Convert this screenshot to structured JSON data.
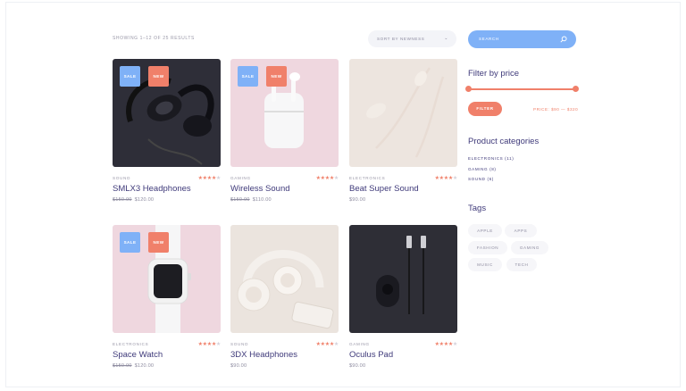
{
  "toolbar": {
    "results": "SHOWING 1–12 OF 25 RESULTS",
    "sort": "SORT BY NEWNESS",
    "search_placeholder": "SEARCH"
  },
  "products": [
    {
      "category": "SOUND",
      "title": "SMLX3 Headphones",
      "old_price": "$150.00",
      "price": "$120.00",
      "rating": 4,
      "badges": [
        "SALE",
        "NEW"
      ]
    },
    {
      "category": "GAMING",
      "title": "Wireless Sound",
      "old_price": "$150.00",
      "price": "$110.00",
      "rating": 4,
      "badges": [
        "SALE",
        "NEW"
      ]
    },
    {
      "category": "ELECTRONICS",
      "title": "Beat Super Sound",
      "old_price": "",
      "price": "$90.00",
      "rating": 4,
      "badges": []
    },
    {
      "category": "ELECTRONICS",
      "title": "Space Watch",
      "old_price": "$150.00",
      "price": "$120.00",
      "rating": 4,
      "badges": [
        "SALE",
        "NEW"
      ]
    },
    {
      "category": "SOUND",
      "title": "3DX Headphones",
      "old_price": "",
      "price": "$90.00",
      "rating": 4,
      "badges": []
    },
    {
      "category": "GAMING",
      "title": "Oculus Pad",
      "old_price": "",
      "price": "$90.00",
      "rating": 4,
      "badges": []
    }
  ],
  "sidebar": {
    "filter_heading": "Filter by price",
    "filter_button": "FILTER",
    "price_range": "PRICE: $90 — $320",
    "categories_heading": "Product categories",
    "categories": [
      "ELECTRONICS (11)",
      "GAMING (8)",
      "SOUND (6)"
    ],
    "tags_heading": "Tags",
    "tags": [
      "APPLE",
      "APPS",
      "FASHION",
      "GAMING",
      "MUSIC",
      "TECH"
    ]
  },
  "colors": {
    "accent": "#f0806a",
    "blue": "#7fb1f7",
    "title": "#3f3a7a"
  }
}
